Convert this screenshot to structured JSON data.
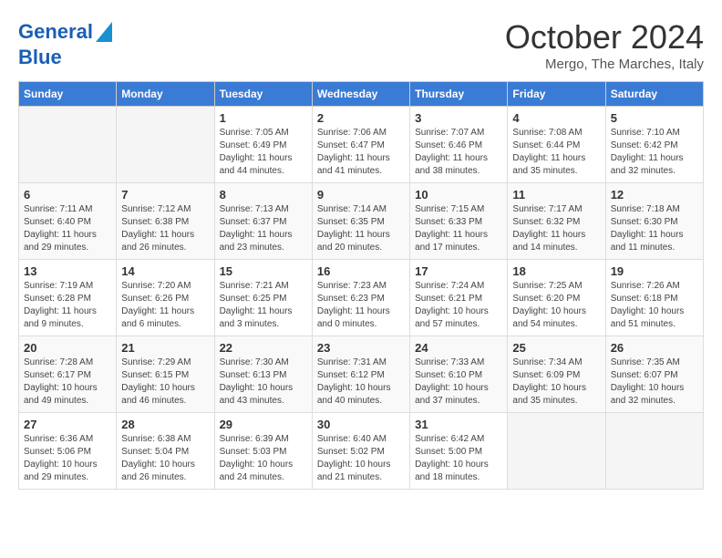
{
  "header": {
    "logo_line1": "General",
    "logo_line2": "Blue",
    "month": "October 2024",
    "location": "Mergo, The Marches, Italy"
  },
  "days_of_week": [
    "Sunday",
    "Monday",
    "Tuesday",
    "Wednesday",
    "Thursday",
    "Friday",
    "Saturday"
  ],
  "weeks": [
    [
      {
        "day": "",
        "sunrise": "",
        "sunset": "",
        "daylight": ""
      },
      {
        "day": "",
        "sunrise": "",
        "sunset": "",
        "daylight": ""
      },
      {
        "day": "1",
        "sunrise": "Sunrise: 7:05 AM",
        "sunset": "Sunset: 6:49 PM",
        "daylight": "Daylight: 11 hours and 44 minutes."
      },
      {
        "day": "2",
        "sunrise": "Sunrise: 7:06 AM",
        "sunset": "Sunset: 6:47 PM",
        "daylight": "Daylight: 11 hours and 41 minutes."
      },
      {
        "day": "3",
        "sunrise": "Sunrise: 7:07 AM",
        "sunset": "Sunset: 6:46 PM",
        "daylight": "Daylight: 11 hours and 38 minutes."
      },
      {
        "day": "4",
        "sunrise": "Sunrise: 7:08 AM",
        "sunset": "Sunset: 6:44 PM",
        "daylight": "Daylight: 11 hours and 35 minutes."
      },
      {
        "day": "5",
        "sunrise": "Sunrise: 7:10 AM",
        "sunset": "Sunset: 6:42 PM",
        "daylight": "Daylight: 11 hours and 32 minutes."
      }
    ],
    [
      {
        "day": "6",
        "sunrise": "Sunrise: 7:11 AM",
        "sunset": "Sunset: 6:40 PM",
        "daylight": "Daylight: 11 hours and 29 minutes."
      },
      {
        "day": "7",
        "sunrise": "Sunrise: 7:12 AM",
        "sunset": "Sunset: 6:38 PM",
        "daylight": "Daylight: 11 hours and 26 minutes."
      },
      {
        "day": "8",
        "sunrise": "Sunrise: 7:13 AM",
        "sunset": "Sunset: 6:37 PM",
        "daylight": "Daylight: 11 hours and 23 minutes."
      },
      {
        "day": "9",
        "sunrise": "Sunrise: 7:14 AM",
        "sunset": "Sunset: 6:35 PM",
        "daylight": "Daylight: 11 hours and 20 minutes."
      },
      {
        "day": "10",
        "sunrise": "Sunrise: 7:15 AM",
        "sunset": "Sunset: 6:33 PM",
        "daylight": "Daylight: 11 hours and 17 minutes."
      },
      {
        "day": "11",
        "sunrise": "Sunrise: 7:17 AM",
        "sunset": "Sunset: 6:32 PM",
        "daylight": "Daylight: 11 hours and 14 minutes."
      },
      {
        "day": "12",
        "sunrise": "Sunrise: 7:18 AM",
        "sunset": "Sunset: 6:30 PM",
        "daylight": "Daylight: 11 hours and 11 minutes."
      }
    ],
    [
      {
        "day": "13",
        "sunrise": "Sunrise: 7:19 AM",
        "sunset": "Sunset: 6:28 PM",
        "daylight": "Daylight: 11 hours and 9 minutes."
      },
      {
        "day": "14",
        "sunrise": "Sunrise: 7:20 AM",
        "sunset": "Sunset: 6:26 PM",
        "daylight": "Daylight: 11 hours and 6 minutes."
      },
      {
        "day": "15",
        "sunrise": "Sunrise: 7:21 AM",
        "sunset": "Sunset: 6:25 PM",
        "daylight": "Daylight: 11 hours and 3 minutes."
      },
      {
        "day": "16",
        "sunrise": "Sunrise: 7:23 AM",
        "sunset": "Sunset: 6:23 PM",
        "daylight": "Daylight: 11 hours and 0 minutes."
      },
      {
        "day": "17",
        "sunrise": "Sunrise: 7:24 AM",
        "sunset": "Sunset: 6:21 PM",
        "daylight": "Daylight: 10 hours and 57 minutes."
      },
      {
        "day": "18",
        "sunrise": "Sunrise: 7:25 AM",
        "sunset": "Sunset: 6:20 PM",
        "daylight": "Daylight: 10 hours and 54 minutes."
      },
      {
        "day": "19",
        "sunrise": "Sunrise: 7:26 AM",
        "sunset": "Sunset: 6:18 PM",
        "daylight": "Daylight: 10 hours and 51 minutes."
      }
    ],
    [
      {
        "day": "20",
        "sunrise": "Sunrise: 7:28 AM",
        "sunset": "Sunset: 6:17 PM",
        "daylight": "Daylight: 10 hours and 49 minutes."
      },
      {
        "day": "21",
        "sunrise": "Sunrise: 7:29 AM",
        "sunset": "Sunset: 6:15 PM",
        "daylight": "Daylight: 10 hours and 46 minutes."
      },
      {
        "day": "22",
        "sunrise": "Sunrise: 7:30 AM",
        "sunset": "Sunset: 6:13 PM",
        "daylight": "Daylight: 10 hours and 43 minutes."
      },
      {
        "day": "23",
        "sunrise": "Sunrise: 7:31 AM",
        "sunset": "Sunset: 6:12 PM",
        "daylight": "Daylight: 10 hours and 40 minutes."
      },
      {
        "day": "24",
        "sunrise": "Sunrise: 7:33 AM",
        "sunset": "Sunset: 6:10 PM",
        "daylight": "Daylight: 10 hours and 37 minutes."
      },
      {
        "day": "25",
        "sunrise": "Sunrise: 7:34 AM",
        "sunset": "Sunset: 6:09 PM",
        "daylight": "Daylight: 10 hours and 35 minutes."
      },
      {
        "day": "26",
        "sunrise": "Sunrise: 7:35 AM",
        "sunset": "Sunset: 6:07 PM",
        "daylight": "Daylight: 10 hours and 32 minutes."
      }
    ],
    [
      {
        "day": "27",
        "sunrise": "Sunrise: 6:36 AM",
        "sunset": "Sunset: 5:06 PM",
        "daylight": "Daylight: 10 hours and 29 minutes."
      },
      {
        "day": "28",
        "sunrise": "Sunrise: 6:38 AM",
        "sunset": "Sunset: 5:04 PM",
        "daylight": "Daylight: 10 hours and 26 minutes."
      },
      {
        "day": "29",
        "sunrise": "Sunrise: 6:39 AM",
        "sunset": "Sunset: 5:03 PM",
        "daylight": "Daylight: 10 hours and 24 minutes."
      },
      {
        "day": "30",
        "sunrise": "Sunrise: 6:40 AM",
        "sunset": "Sunset: 5:02 PM",
        "daylight": "Daylight: 10 hours and 21 minutes."
      },
      {
        "day": "31",
        "sunrise": "Sunrise: 6:42 AM",
        "sunset": "Sunset: 5:00 PM",
        "daylight": "Daylight: 10 hours and 18 minutes."
      },
      {
        "day": "",
        "sunrise": "",
        "sunset": "",
        "daylight": ""
      },
      {
        "day": "",
        "sunrise": "",
        "sunset": "",
        "daylight": ""
      }
    ]
  ]
}
